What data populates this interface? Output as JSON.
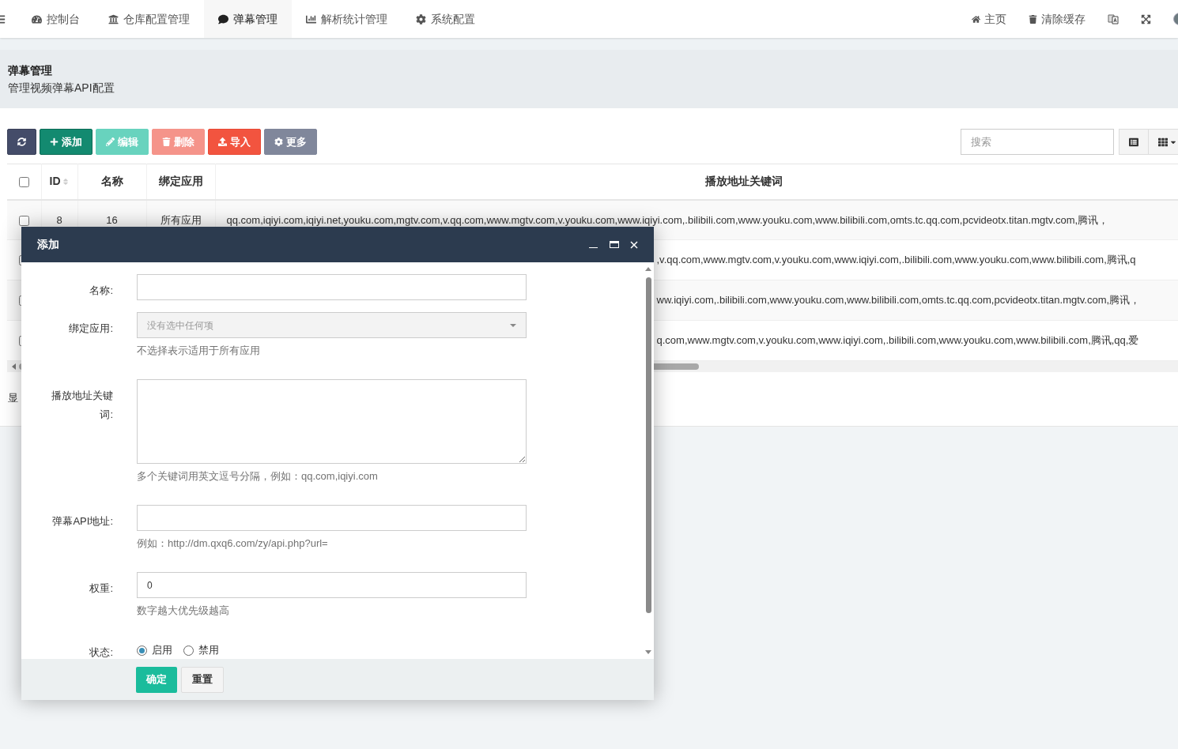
{
  "navbar": {
    "tabs": [
      {
        "label": "控制台",
        "selected": false
      },
      {
        "label": "仓库配置管理",
        "selected": false
      },
      {
        "label": "弹幕管理",
        "selected": true
      },
      {
        "label": "解析统计管理",
        "selected": false
      },
      {
        "label": "系统配置",
        "selected": false
      }
    ],
    "right_links": [
      {
        "label": "主页"
      },
      {
        "label": "清除缓存"
      }
    ]
  },
  "page_header": {
    "title": "弹幕管理",
    "subtitle": "管理视频弹幕API配置"
  },
  "toolbar": {
    "buttons": [
      {
        "kind": "refresh",
        "disabled": false
      },
      {
        "kind": "add",
        "label": "添加",
        "disabled": false
      },
      {
        "kind": "edit",
        "label": "编辑",
        "disabled": true
      },
      {
        "kind": "delete",
        "label": "删除",
        "disabled": true
      },
      {
        "kind": "import",
        "label": "导入",
        "disabled": false
      },
      {
        "kind": "more",
        "label": "更多",
        "disabled": false
      }
    ],
    "search": {
      "placeholder": "搜索"
    }
  },
  "table": {
    "select_all_checked": false,
    "columns": [
      {
        "label": "ID",
        "sortable": true
      },
      {
        "label": "名称",
        "sortable": false
      },
      {
        "label": "绑定应用",
        "sortable": false
      },
      {
        "label": "播放地址关键词",
        "sortable": false
      }
    ],
    "rows": [
      {
        "checked": false,
        "id": "8",
        "name": "16",
        "app": "所有应用",
        "keywords": "qq.com,iqiyi.com,iqiyi.net,youku.com,mgtv.com,v.qq.com,www.mgtv.com,v.youku.com,www.iqiyi.com,.bilibili.com,www.youku.com,www.bilibili.com,omts.tc.qq.com,pcvideotx.titan.mgtv.com,腾讯，"
      },
      {
        "checked": false,
        "keywords": ",v.qq.com,www.mgtv.com,v.youku.com,www.iqiyi.com,.bilibili.com,www.youku.com,www.bilibili.com,腾讯,q"
      },
      {
        "checked": false,
        "keywords": "ww.iqiyi.com,.bilibili.com,www.youku.com,www.bilibili.com,omts.tc.qq.com,pcvideotx.titan.mgtv.com,腾讯，"
      },
      {
        "checked": false,
        "keywords": "q.com,www.mgtv.com,v.youku.com,www.iqiyi.com,.bilibili.com,www.youku.com,www.bilibili.com,腾讯,qq,爱"
      }
    ]
  },
  "pagination_text": "显",
  "modal": {
    "title": "添加",
    "fields": [
      {
        "kind": "text",
        "label": "名称:"
      },
      {
        "kind": "select",
        "label": "绑定应用:",
        "placeholder": "没有选中任何项",
        "help": "不选择表示适用于所有应用"
      },
      {
        "kind": "textarea",
        "label": "播放地址关键词:",
        "help": "多个关键词用英文逗号分隔，例如：qq.com,iqiyi.com"
      },
      {
        "kind": "text",
        "label": "弹幕API地址:",
        "help": "例如：http://dm.qxq6.com/zy/api.php?url="
      },
      {
        "kind": "text",
        "label": "权重:",
        "value": "0",
        "help": "数字越大优先级越高"
      },
      {
        "kind": "radio",
        "label": "状态:",
        "options": [
          {
            "label": "启用",
            "selected": true
          },
          {
            "label": "禁用",
            "selected": false
          }
        ]
      }
    ],
    "buttons": [
      {
        "kind": "primary",
        "label": "确定"
      },
      {
        "kind": "default",
        "label": "重置"
      }
    ]
  }
}
